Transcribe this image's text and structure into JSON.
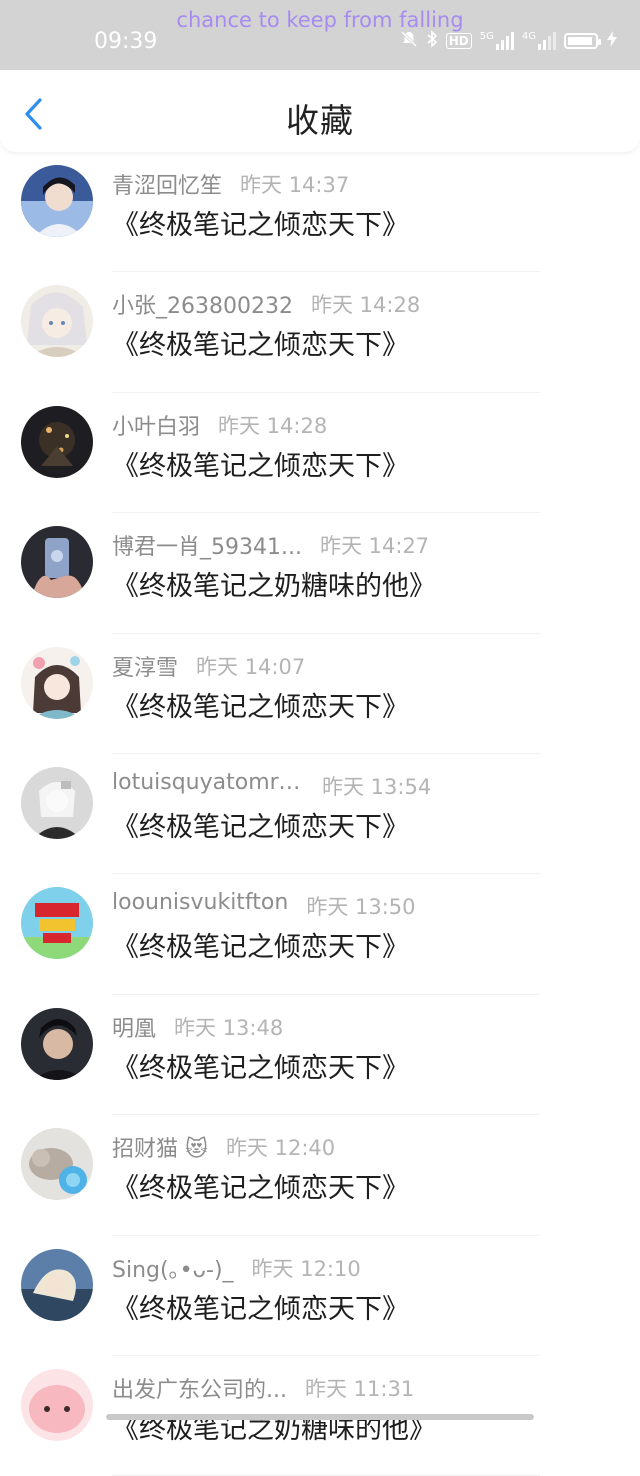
{
  "status_bar": {
    "marquee": "chance to keep from falling",
    "time": "09:39",
    "hd_label": "HD",
    "net1": "5G",
    "net2": "4G"
  },
  "header": {
    "title": "收藏"
  },
  "items": [
    {
      "name": "青涩回忆笙",
      "time": "昨天 14:37",
      "book": "《终极笔记之倾恋天下》"
    },
    {
      "name": "小张_263800232",
      "time": "昨天 14:28",
      "book": "《终极笔记之倾恋天下》"
    },
    {
      "name": "小叶白羽",
      "time": "昨天 14:28",
      "book": "《终极笔记之倾恋天下》"
    },
    {
      "name": "博君一肖_59341...",
      "time": "昨天 14:27",
      "book": "《终极笔记之奶糖味的他》"
    },
    {
      "name": "夏淳雪",
      "time": "昨天 14:07",
      "book": "《终极笔记之倾恋天下》"
    },
    {
      "name": "lotuisquyatomrn...",
      "time": "昨天 13:54",
      "book": "《终极笔记之倾恋天下》"
    },
    {
      "name": "loounisvukitfton",
      "time": "昨天 13:50",
      "book": "《终极笔记之倾恋天下》"
    },
    {
      "name": "明凰",
      "time": "昨天 13:48",
      "book": "《终极笔记之倾恋天下》"
    },
    {
      "name": "招财猫 😻",
      "time": "昨天 12:40",
      "book": "《终极笔记之倾恋天下》"
    },
    {
      "name": "Sing(｡•ᴗ-)_",
      "time": "昨天 12:10",
      "book": "《终极笔记之倾恋天下》"
    },
    {
      "name": "出发广东公司的...",
      "time": "昨天 11:31",
      "book": "《终极笔记之奶糖味的他》"
    }
  ],
  "colors": {
    "accent": "#2e8ef0",
    "name_gray": "#8c8c8c",
    "time_gray": "#b4b4b4",
    "marquee": "#a78bf0"
  }
}
